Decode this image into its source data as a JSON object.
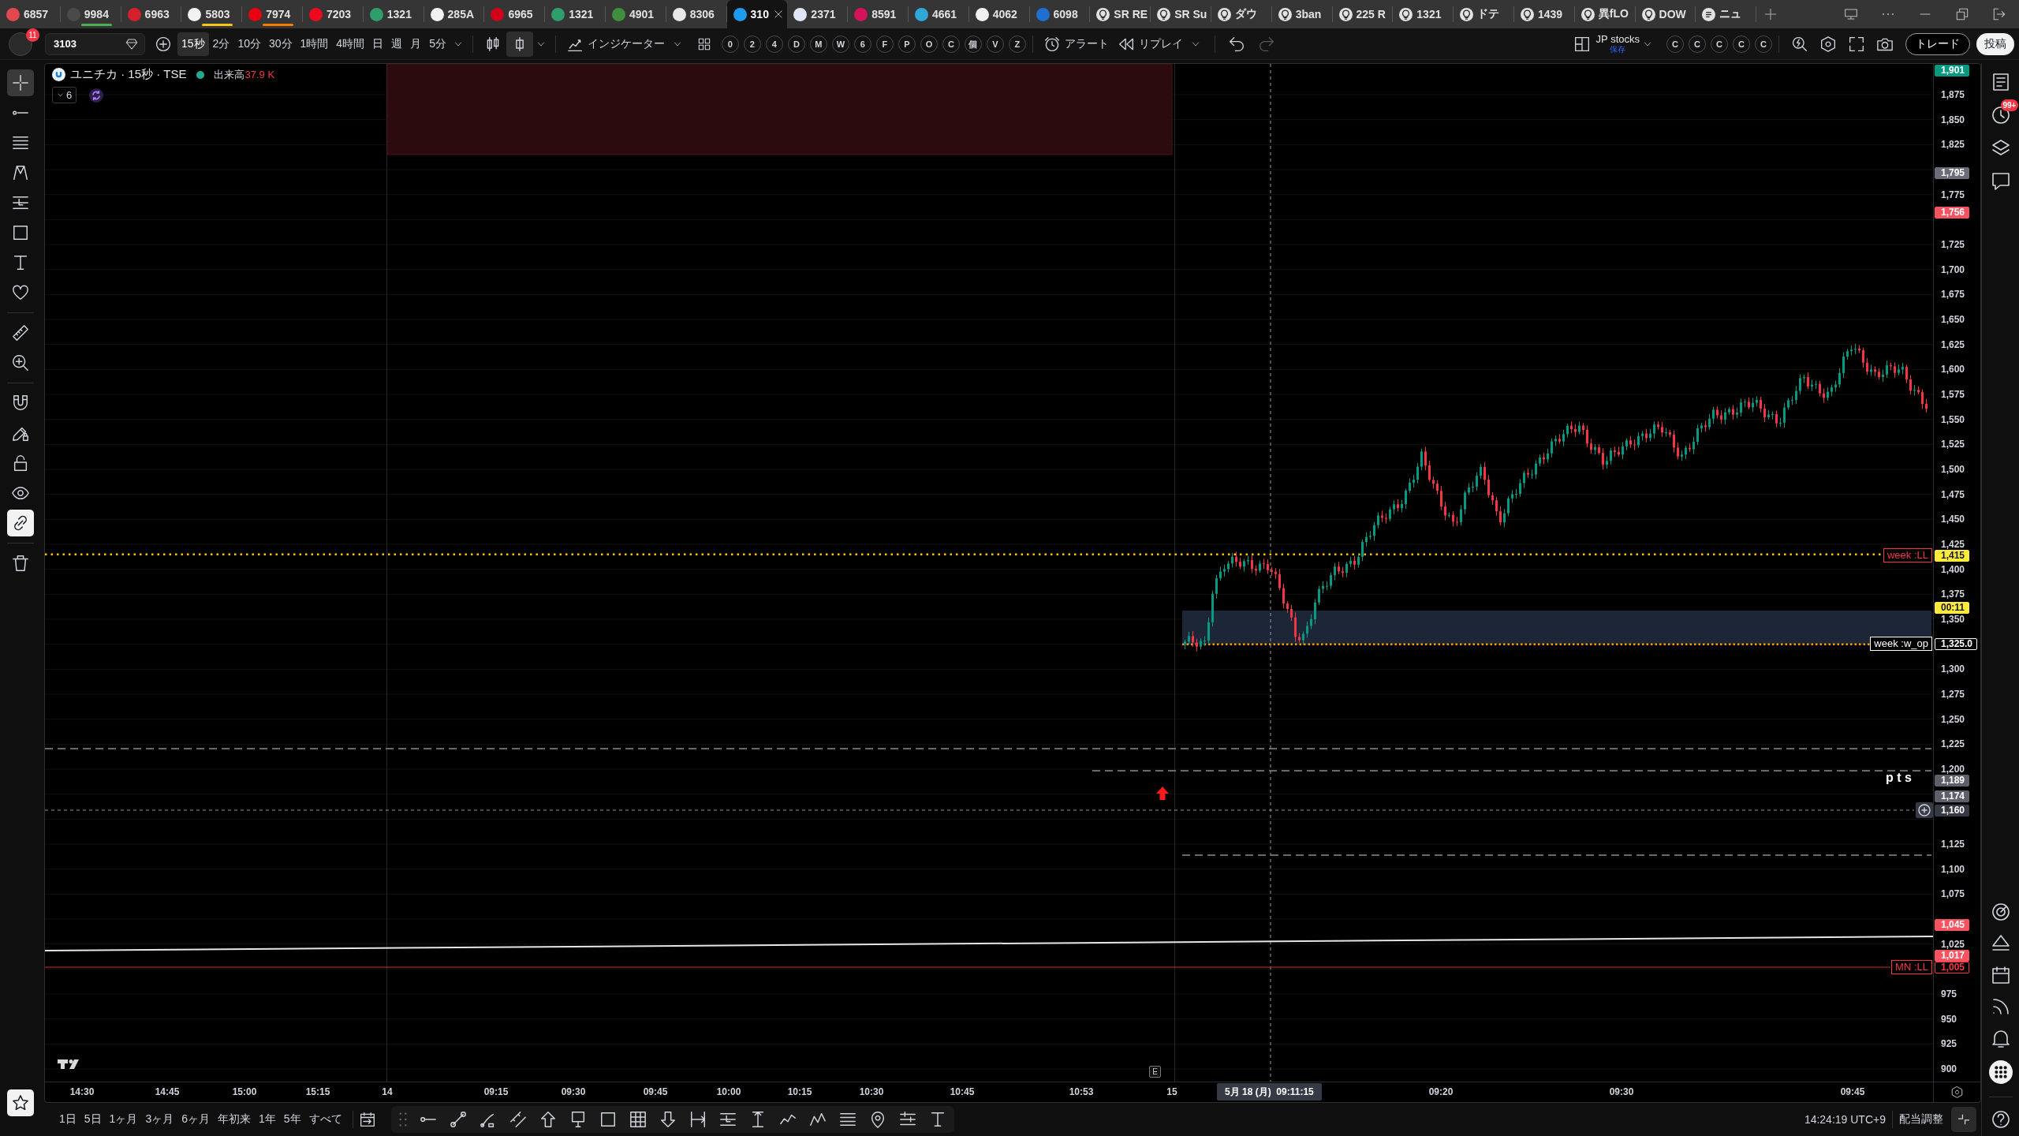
{
  "browser_tabs": [
    {
      "label": "6857",
      "kind": "logo",
      "icon": {
        "color": "#e34850"
      },
      "selected": false
    },
    {
      "label": "9984",
      "kind": "logo",
      "icon": {
        "color": "#4a4a4a"
      },
      "marker": {
        "color": "#4caf50"
      },
      "selected": false
    },
    {
      "label": "6963",
      "kind": "logo",
      "icon": {
        "color": "#d4202a"
      },
      "selected": false
    },
    {
      "label": "5803",
      "kind": "logo",
      "icon": {
        "color": "#f2f2f2"
      },
      "marker": {
        "color": "#f5c518"
      },
      "selected": false
    },
    {
      "label": "7974",
      "kind": "logo",
      "icon": {
        "color": "#e60012"
      },
      "marker": {
        "color": "#f57c00"
      },
      "selected": false
    },
    {
      "label": "7203",
      "kind": "logo",
      "icon": {
        "color": "#eb0a1e"
      },
      "selected": false
    },
    {
      "label": "1321",
      "kind": "logo",
      "icon": {
        "color": "#2e9e6a"
      },
      "selected": false
    },
    {
      "label": "285A",
      "kind": "logo",
      "icon": {
        "color": "#f2f2f2"
      },
      "selected": false
    },
    {
      "label": "6965",
      "kind": "logo",
      "icon": {
        "color": "#d0021b"
      },
      "selected": false
    },
    {
      "label": "1321",
      "kind": "logo",
      "icon": {
        "color": "#2e9e6a"
      },
      "selected": false
    },
    {
      "label": "4901",
      "kind": "logo",
      "icon": {
        "color": "#3f8f3f"
      },
      "selected": false
    },
    {
      "label": "8306",
      "kind": "logo",
      "icon": {
        "color": "#e8e8e8"
      },
      "selected": false
    },
    {
      "label": "310",
      "kind": "logo",
      "icon": {
        "color": "#1d9bf0"
      },
      "selected": true
    },
    {
      "label": "2371",
      "kind": "logo",
      "icon": {
        "color": "#dfe7f5"
      },
      "selected": false
    },
    {
      "label": "8591",
      "kind": "logo",
      "icon": {
        "color": "#d4145a"
      },
      "selected": false
    },
    {
      "label": "4661",
      "kind": "logo",
      "icon": {
        "color": "#2fa8d8"
      },
      "selected": false
    },
    {
      "label": "4062",
      "kind": "logo",
      "icon": {
        "color": "#f2f2f2"
      },
      "selected": false
    },
    {
      "label": "6098",
      "kind": "logo",
      "icon": {
        "color": "#1f6fd1"
      },
      "selected": false
    },
    {
      "label": "SR RE",
      "kind": "idea",
      "selected": false
    },
    {
      "label": "SR Su",
      "kind": "idea",
      "selected": false
    },
    {
      "label": "ダウ",
      "kind": "idea",
      "selected": false
    },
    {
      "label": "3ban",
      "kind": "idea",
      "selected": false
    },
    {
      "label": "225 R",
      "kind": "idea",
      "selected": false
    },
    {
      "label": "1321",
      "kind": "idea",
      "selected": false
    },
    {
      "label": "ドテ",
      "kind": "idea",
      "selected": false
    },
    {
      "label": "1439",
      "kind": "idea",
      "selected": false
    },
    {
      "label": "異fLO",
      "kind": "idea",
      "selected": false
    },
    {
      "label": "DOW",
      "kind": "idea",
      "selected": false
    },
    {
      "label": "ニュ",
      "kind": "news",
      "selected": false
    }
  ],
  "toolbar": {
    "notification_count": "11",
    "symbol_field": {
      "value": "3103"
    },
    "intervals": [
      {
        "label": "15秒",
        "selected": true
      },
      {
        "label": "2分",
        "selected": false
      },
      {
        "label": "10分",
        "selected": false
      },
      {
        "label": "30分",
        "selected": false
      },
      {
        "label": "1時間",
        "selected": false
      },
      {
        "label": "4時間",
        "selected": false
      },
      {
        "label": "日",
        "selected": false
      },
      {
        "label": "週",
        "selected": false
      },
      {
        "label": "月",
        "selected": false
      },
      {
        "label": "5分",
        "selected": false
      }
    ],
    "chart_styles": [
      {
        "kind": "candles",
        "selected": false
      },
      {
        "kind": "hollow-candle",
        "selected": true
      }
    ],
    "indicators_label": "インジケーター",
    "shortcut_buttons": [
      "0",
      "2",
      "4",
      "D",
      "M",
      "W",
      "6",
      "F",
      "P",
      "O",
      "C",
      "個",
      "V",
      "Z"
    ],
    "alert_label": "アラート",
    "replay_label": "リプレイ",
    "layout": {
      "name": "JP stocks",
      "status": "保存"
    },
    "layout_shortcuts": [
      "C",
      "C",
      "C",
      "C",
      "C"
    ],
    "trade_label": "トレード",
    "publish_label": "投稿"
  },
  "left_toolbar": {
    "groups": [
      {
        "items": [
          {
            "kind": "crosshair",
            "selected": true
          },
          {
            "kind": "trend-line",
            "selected": false
          },
          {
            "kind": "lines",
            "selected": false
          },
          {
            "kind": "pattern",
            "selected": false
          },
          {
            "kind": "ruled-lines",
            "selected": false
          },
          {
            "kind": "rectangle",
            "selected": false
          },
          {
            "kind": "text",
            "selected": false
          },
          {
            "kind": "heart",
            "selected": false
          }
        ]
      },
      {
        "items": [
          {
            "kind": "ruler",
            "selected": false
          },
          {
            "kind": "zoom-in",
            "selected": false
          }
        ]
      },
      {
        "items": [
          {
            "kind": "magnet",
            "on": false
          },
          {
            "kind": "pencil-lock",
            "on": false
          },
          {
            "kind": "lock",
            "on": false
          },
          {
            "kind": "eye",
            "on": false
          },
          {
            "kind": "link",
            "on": true
          }
        ]
      },
      {
        "items": [
          {
            "kind": "trash"
          }
        ]
      }
    ],
    "favorites": {
      "on": true
    }
  },
  "chart": {
    "legend": {
      "title": "ユニチカ · 15秒 · TSE",
      "status": {
        "color": "#22ab94"
      },
      "volume_label": "出来高",
      "volume_value": "37.9 K",
      "indicator_count": "6"
    },
    "price_axis": {
      "labels": [
        "1,875",
        "1,850",
        "1,825",
        "1,775",
        "1,725",
        "1,700",
        "1,675",
        "1,650",
        "1,625",
        "1,600",
        "1,575",
        "1,550",
        "1,525",
        "1,500",
        "1,475",
        "1,450",
        "1,425",
        "1,400",
        "1,375",
        "1,350",
        "1,300",
        "1,275",
        "1,250",
        "1,225",
        "1,200",
        "1,125",
        "1,100",
        "1,075",
        "1,025",
        "975",
        "950",
        "925",
        "900"
      ]
    },
    "price_tags": [
      {
        "text": "1,901",
        "kind": "filled",
        "color": "#089981"
      },
      {
        "text": "1,795",
        "kind": "filled",
        "color": "#6a6d78"
      },
      {
        "text": "1,756",
        "kind": "filled",
        "color": "#f7525f"
      },
      {
        "text": "1,415",
        "kind": "filled",
        "color": "#ffeb3b",
        "label": {
          "text": "week :LL",
          "color": "#f23645"
        }
      },
      {
        "text": "00:11",
        "kind": "filled",
        "color": "#ffeb3b"
      },
      {
        "text": "1,325.0",
        "kind": "outlined",
        "color": "#ffffff",
        "label": {
          "text": "week :w_op",
          "color": "#ffffff"
        }
      },
      {
        "text": "1,189",
        "kind": "filled",
        "color": "#5d606b"
      },
      {
        "text": "1,174",
        "kind": "filled",
        "color": "#5d606b"
      },
      {
        "text": "1,160",
        "kind": "crosshair",
        "color": "#363a45"
      },
      {
        "text": "1,045",
        "kind": "filled",
        "color": "#f7525f"
      },
      {
        "text": "1,017",
        "kind": "filled",
        "color": "#f7525f"
      },
      {
        "text": "1,005",
        "kind": "outlined",
        "color": "#f23645",
        "label": {
          "text": "MN :LL",
          "color": "#f23645"
        }
      }
    ],
    "series_label": "p t s",
    "event_marker": "E",
    "time_axis": {
      "labels": [
        "14:30",
        "14:45",
        "15:00",
        "15:15",
        "14",
        "09:15",
        "09:30",
        "09:45",
        "10:00",
        "10:15",
        "10:30",
        "10:45",
        "10:53",
        "15",
        "09:20",
        "09:30",
        "09:45"
      ],
      "crosshair_label": "5月 18 (月)  09:11:15"
    }
  },
  "right_sidebar": {
    "alerts_badge": "99+"
  },
  "bottom_bar": {
    "ranges": [
      "1日",
      "5日",
      "1ヶ月",
      "3ヶ月",
      "6ヶ月",
      "年初来",
      "1年",
      "5年",
      "すべて"
    ],
    "clock": "14:24:19 UTC+9",
    "adjustment_label": "配当調整"
  }
}
